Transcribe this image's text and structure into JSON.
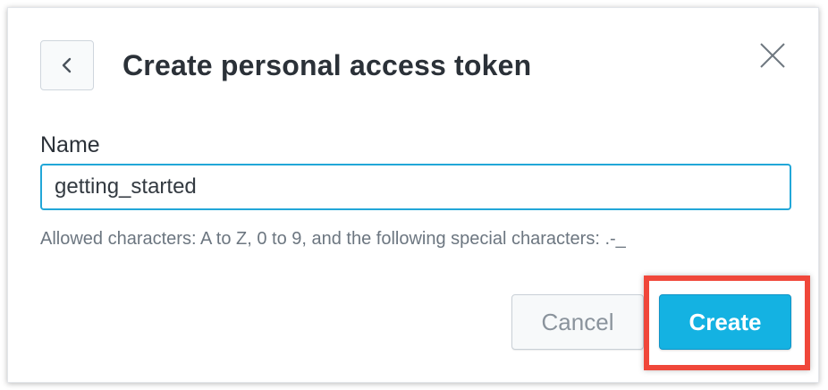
{
  "dialog": {
    "title": "Create personal access token",
    "back_icon": "chevron-left-icon",
    "close_icon": "close-icon"
  },
  "form": {
    "name_label": "Name",
    "name_value": "getting_started",
    "hint": "Allowed characters: A to Z, 0 to 9, and the following special characters: .-_"
  },
  "actions": {
    "cancel_label": "Cancel",
    "create_label": "Create"
  },
  "colors": {
    "accent": "#14b2e2",
    "input_focus_border": "#22a7d8",
    "highlight_annotation": "#f0473a",
    "title_text": "#2b3138",
    "hint_text": "#6c7680"
  }
}
